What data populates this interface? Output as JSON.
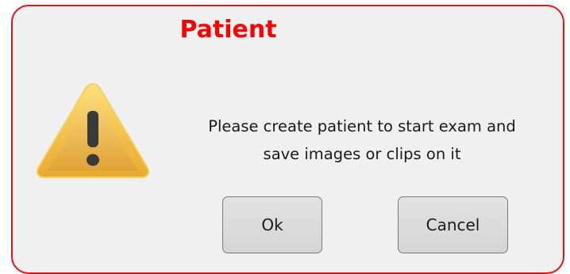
{
  "dialog": {
    "title": "Patient",
    "message_line1": "Please create patient to start exam and",
    "message_line2": "save images or clips on it",
    "icon": "warning-icon",
    "ok_label": "Ok",
    "cancel_label": "Cancel"
  },
  "colors": {
    "title": "#ff0000",
    "border": "#e0141b",
    "background": "#f0f0f0",
    "warning_fill": "#f5c842"
  }
}
